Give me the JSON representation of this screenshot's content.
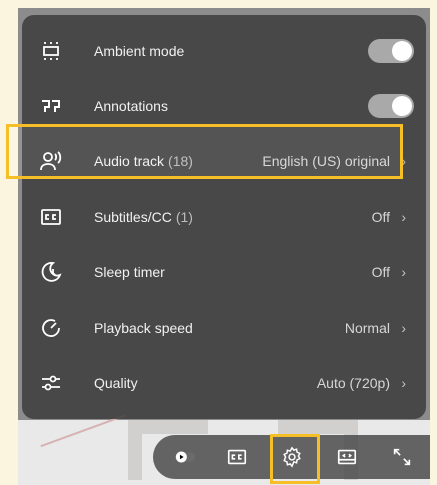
{
  "menu": {
    "items": [
      {
        "icon": "ambient-mode-icon",
        "label": "Ambient mode",
        "type": "toggle",
        "enabled": true
      },
      {
        "icon": "annotations-icon",
        "label": "Annotations",
        "type": "toggle",
        "enabled": true
      },
      {
        "icon": "audio-track-icon",
        "label": "Audio track",
        "count": "(18)",
        "value": "English (US) original",
        "chevron": "›"
      },
      {
        "icon": "subtitles-icon",
        "label": "Subtitles/CC",
        "count": "(1)",
        "value": "Off",
        "chevron": "›"
      },
      {
        "icon": "sleep-timer-icon",
        "label": "Sleep timer",
        "value": "Off",
        "chevron": "›"
      },
      {
        "icon": "playback-speed-icon",
        "label": "Playback speed",
        "value": "Normal",
        "chevron": "›"
      },
      {
        "icon": "quality-icon",
        "label": "Quality",
        "value": "Auto (720p)",
        "chevron": "›"
      }
    ]
  },
  "controls": {
    "buttons": [
      "autoplay-toggle",
      "subtitles-button",
      "settings-button",
      "theater-mode-button",
      "fullscreen-button"
    ]
  },
  "colors": {
    "highlight": "#f6bf26",
    "menu_bg": "#3c3c3c",
    "page_bg": "#fbf5df"
  }
}
